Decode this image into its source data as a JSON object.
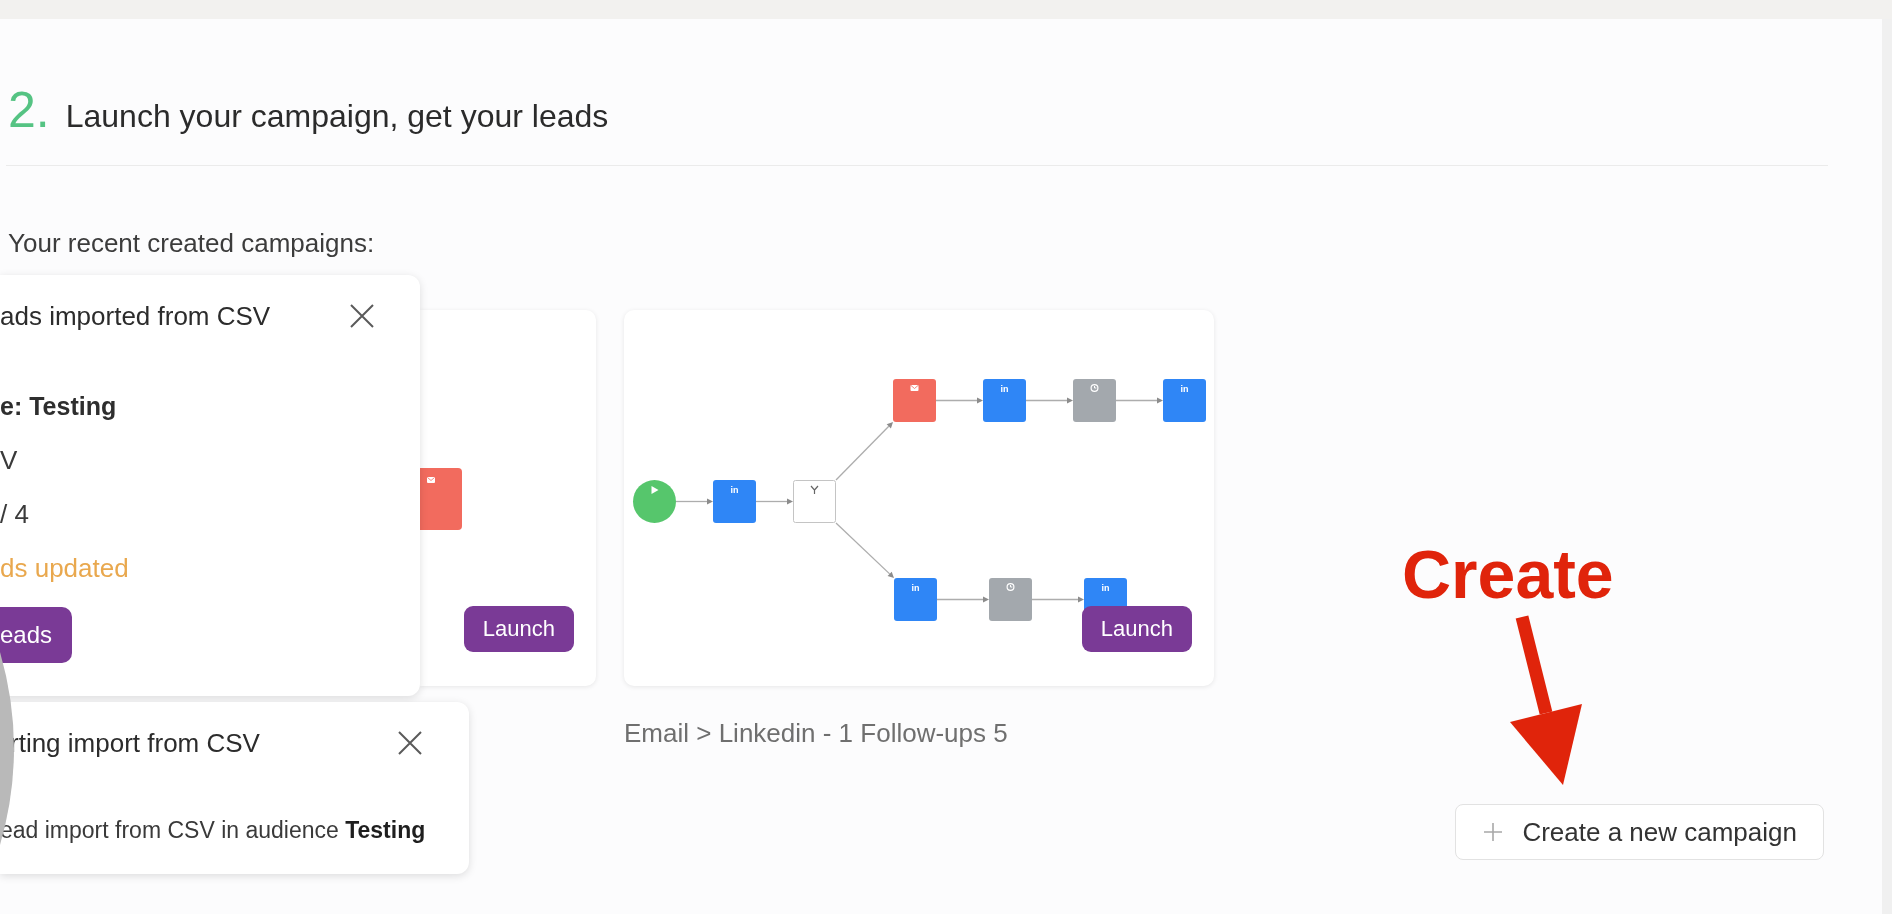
{
  "section": {
    "number": "2.",
    "title": "Launch your campaign, get your leads"
  },
  "recent_label": "Your recent created campaigns:",
  "campaigns": [
    {
      "kind": "covered",
      "nodes": [
        {
          "kind": "email"
        }
      ],
      "button": "Launch"
    },
    {
      "kind": "full",
      "flow": {
        "main": [
          {
            "kind": "start"
          },
          {
            "kind": "linkedin",
            "glyph": "in"
          },
          {
            "kind": "condition"
          }
        ],
        "top_branch": [
          {
            "kind": "email"
          },
          {
            "kind": "linkedin",
            "glyph": "in"
          },
          {
            "kind": "wait"
          },
          {
            "kind": "linkedin",
            "glyph": "in"
          }
        ],
        "bottom_branch": [
          {
            "kind": "linkedin",
            "glyph": "in"
          },
          {
            "kind": "wait"
          },
          {
            "kind": "linkedin",
            "glyph": "in"
          }
        ]
      },
      "button": "Launch",
      "caption": "Email > Linkedin - 1 Follow-ups 5"
    }
  ],
  "create_button": {
    "label": "Create a new campaign"
  },
  "toasts": [
    {
      "title": "ads imported from CSV",
      "lines": [
        {
          "kind": "strong",
          "text": "e: Testing"
        },
        {
          "kind": "plain",
          "text": "V"
        },
        {
          "kind": "plain",
          "text": "/ 4"
        },
        {
          "kind": "warning",
          "text": "ds updated"
        }
      ],
      "button": "eads"
    },
    {
      "title": "rting import from CSV",
      "body": "ead import from CSV in audience **Testing**"
    }
  ],
  "annotation": {
    "text": "Create"
  }
}
